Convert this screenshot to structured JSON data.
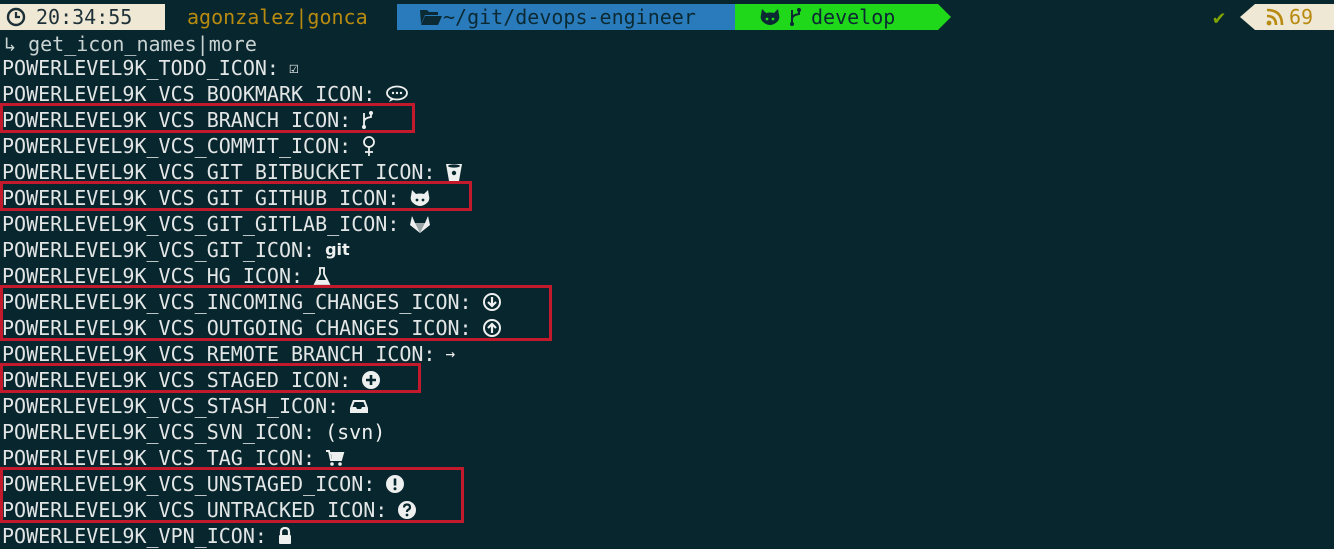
{
  "prompt": {
    "time": "20:34:55",
    "user": "agonzalez|gonca",
    "dir": "~/git/devops-engineer",
    "branch": "develop",
    "status_mark": "✔",
    "rss_count": "69",
    "colors": {
      "time_bg": "#eee8d5",
      "dir_bg": "#2a7bbc",
      "vcs_bg": "#1fd81a",
      "user_fg": "#b78a10",
      "highlight": "#c2192c"
    }
  },
  "command": "↳ get_icon_names|more",
  "lines": [
    {
      "label": "POWERLEVEL9K_TODO_ICON:",
      "icon": "ballot-box-check-icon",
      "icon_text": "☑"
    },
    {
      "label": "POWERLEVEL9K_VCS_BOOKMARK_ICON:",
      "icon": "speech-bubble-icon"
    },
    {
      "label": "POWERLEVEL9K_VCS_BRANCH_ICON:",
      "icon": "git-branch-icon"
    },
    {
      "label": "POWERLEVEL9K_VCS_COMMIT_ICON:",
      "icon": "git-commit-icon"
    },
    {
      "label": "POWERLEVEL9K_VCS_GIT_BITBUCKET_ICON:",
      "icon": "bitbucket-icon"
    },
    {
      "label": "POWERLEVEL9K_VCS_GIT_GITHUB_ICON:",
      "icon": "github-octocat-icon"
    },
    {
      "label": "POWERLEVEL9K_VCS_GIT_GITLAB_ICON:",
      "icon": "gitlab-icon"
    },
    {
      "label": "POWERLEVEL9K_VCS_GIT_ICON:",
      "icon": "git-text-icon",
      "icon_text": "git"
    },
    {
      "label": "POWERLEVEL9K_VCS_HG_ICON:",
      "icon": "flask-icon"
    },
    {
      "label": "POWERLEVEL9K_VCS_INCOMING_CHANGES_ICON:",
      "icon": "arrow-circle-down-icon"
    },
    {
      "label": "POWERLEVEL9K_VCS_OUTGOING_CHANGES_ICON:",
      "icon": "arrow-circle-up-icon"
    },
    {
      "label": "POWERLEVEL9K_VCS_REMOTE_BRANCH_ICON:",
      "icon": "arrow-right-icon",
      "icon_text": "→"
    },
    {
      "label": "POWERLEVEL9K_VCS_STAGED_ICON:",
      "icon": "plus-circle-icon"
    },
    {
      "label": "POWERLEVEL9K_VCS_STASH_ICON:",
      "icon": "inbox-tray-icon"
    },
    {
      "label": "POWERLEVEL9K_VCS_SVN_ICON:",
      "icon": "svn-text-icon",
      "icon_text": "(svn)"
    },
    {
      "label": "POWERLEVEL9K_VCS_TAG_ICON:",
      "icon": "shopping-cart-icon"
    },
    {
      "label": "POWERLEVEL9K_VCS_UNSTAGED_ICON:",
      "icon": "exclamation-circle-icon"
    },
    {
      "label": "POWERLEVEL9K_VCS_UNTRACKED_ICON:",
      "icon": "question-circle-icon"
    },
    {
      "label": "POWERLEVEL9K_VPN_ICON:",
      "icon": "lock-icon"
    }
  ]
}
